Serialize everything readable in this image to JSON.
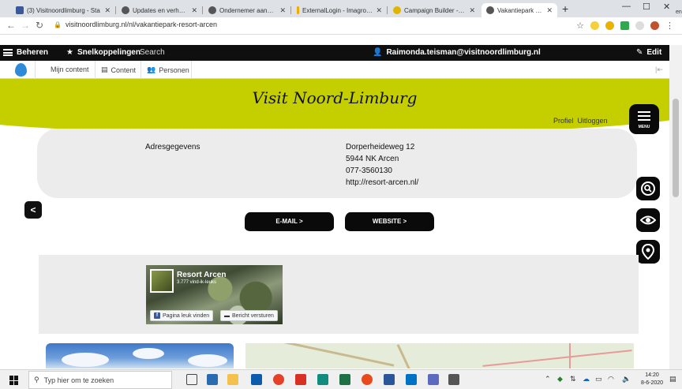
{
  "browser": {
    "tabs": [
      {
        "title": "(3) Visitnoordlimburg - Sta",
        "favicon_color": "#3b5998"
      },
      {
        "title": "Updates en verhalen | Visit",
        "favicon_color": "#444444"
      },
      {
        "title": "Ondernemer aanmaken | V",
        "favicon_color": "#444444"
      },
      {
        "title": "ExternalLogin - Imagro bee",
        "favicon_color": "#f2a900"
      },
      {
        "title": "Campaign Builder - Templ",
        "favicon_color": "#e0b400"
      },
      {
        "title": "Vakantiepark Resort Arcen",
        "favicon_color": "#444444",
        "active": true
      }
    ],
    "url": "visitnoordlimburg.nl/nl/vakantiepark-resort-arcen",
    "edge_text": "en"
  },
  "admin_toolbar": {
    "manage": "Beheren",
    "shortcuts": "Snelkoppelingen",
    "search": "Search",
    "user": "Raimonda.teisman@visitnoordlimburg.nl",
    "edit": "Edit",
    "sub": {
      "my_content": "Mijn content",
      "content": "Content",
      "people": "Personen"
    }
  },
  "site": {
    "logo_text": "Visit Noord-Limburg",
    "profile": "Profiel",
    "logout": "Uitloggen",
    "menu_label": "MENU",
    "accent": "#c5cf00"
  },
  "address": {
    "label": "Adresgegevens",
    "street": "Dorperheideweg 12",
    "postal": "5944 NK Arcen",
    "phone": "077-3560130",
    "website": "http://resort-arcen.nl/"
  },
  "buttons": {
    "email": "E-MAIL >",
    "website": "WEBSITE >",
    "back": "<"
  },
  "facebook": {
    "page_name": "Resort Arcen",
    "likes": "3.777 vind-ik-leuks",
    "like_button": "Pagina leuk vinden",
    "message_button": "Bericht versturen"
  },
  "taskbar": {
    "search_placeholder": "Typ hier om te zoeken",
    "time": "14:20",
    "date": "8-6-2020"
  }
}
